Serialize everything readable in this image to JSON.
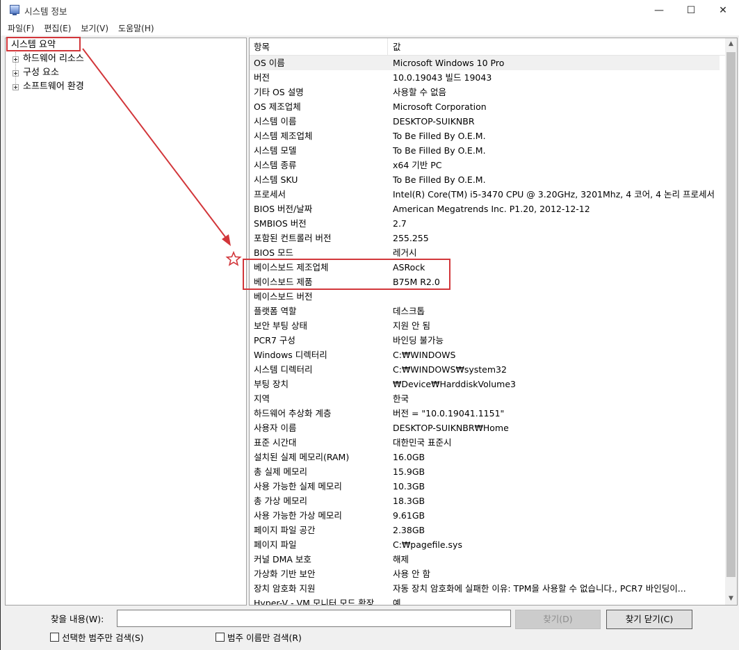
{
  "window": {
    "title": "시스템 정보",
    "minimize": "—",
    "maximize": "☐",
    "close": "✕"
  },
  "menu": [
    "파일(F)",
    "편집(E)",
    "보기(V)",
    "도움말(H)"
  ],
  "tree": {
    "root": "시스템 요약",
    "children": [
      "하드웨어 리소스",
      "구성 요소",
      "소프트웨어 환경"
    ]
  },
  "list": {
    "header_key": "항목",
    "header_value": "값",
    "rows": [
      {
        "key": "OS 이름",
        "value": "Microsoft Windows 10 Pro"
      },
      {
        "key": "버전",
        "value": "10.0.19043 빌드 19043"
      },
      {
        "key": "기타 OS 설명",
        "value": "사용할 수 없음"
      },
      {
        "key": "OS 제조업체",
        "value": "Microsoft Corporation"
      },
      {
        "key": "시스템 이름",
        "value": "DESKTOP-SUIKNBR"
      },
      {
        "key": "시스템 제조업체",
        "value": "To Be Filled By O.E.M."
      },
      {
        "key": "시스템 모델",
        "value": "To Be Filled By O.E.M."
      },
      {
        "key": "시스템 종류",
        "value": "x64 기반 PC"
      },
      {
        "key": "시스템 SKU",
        "value": "To Be Filled By O.E.M."
      },
      {
        "key": "프로세서",
        "value": "Intel(R) Core(TM) i5-3470 CPU @ 3.20GHz, 3201Mhz, 4 코어, 4 논리 프로세서"
      },
      {
        "key": "BIOS 버전/날짜",
        "value": "American Megatrends Inc. P1.20, 2012-12-12"
      },
      {
        "key": "SMBIOS 버전",
        "value": "2.7"
      },
      {
        "key": "포함된 컨트롤러 버전",
        "value": "255.255"
      },
      {
        "key": "BIOS 모드",
        "value": "레거시"
      },
      {
        "key": "베이스보드 제조업체",
        "value": "ASRock"
      },
      {
        "key": "베이스보드 제품",
        "value": "B75M R2.0"
      },
      {
        "key": "베이스보드 버전",
        "value": ""
      },
      {
        "key": "플랫폼 역할",
        "value": "데스크톱"
      },
      {
        "key": "보안 부팅 상태",
        "value": "지원 안 됨"
      },
      {
        "key": "PCR7 구성",
        "value": "바인딩 불가능"
      },
      {
        "key": "Windows 디렉터리",
        "value": "C:₩WINDOWS"
      },
      {
        "key": "시스템 디렉터리",
        "value": "C:₩WINDOWS₩system32"
      },
      {
        "key": "부팅 장치",
        "value": "₩Device₩HarddiskVolume3"
      },
      {
        "key": "지역",
        "value": "한국"
      },
      {
        "key": "하드웨어 추상화 계층",
        "value": "버전 = \"10.0.19041.1151\""
      },
      {
        "key": "사용자 이름",
        "value": "DESKTOP-SUIKNBR₩Home"
      },
      {
        "key": "표준 시간대",
        "value": "대한민국 표준시"
      },
      {
        "key": "설치된 실제 메모리(RAM)",
        "value": "16.0GB"
      },
      {
        "key": "총 실제 메모리",
        "value": "15.9GB"
      },
      {
        "key": "사용 가능한 실제 메모리",
        "value": "10.3GB"
      },
      {
        "key": "총 가상 메모리",
        "value": "18.3GB"
      },
      {
        "key": "사용 가능한 가상 메모리",
        "value": "9.61GB"
      },
      {
        "key": "페이지 파일 공간",
        "value": "2.38GB"
      },
      {
        "key": "페이지 파일",
        "value": "C:₩pagefile.sys"
      },
      {
        "key": "커널 DMA 보호",
        "value": "해제"
      },
      {
        "key": "가상화 기반 보안",
        "value": "사용 안 함"
      },
      {
        "key": "장치 암호화 지원",
        "value": "자동 장치 암호화에 실패한 이유: TPM을 사용할 수 없습니다., PCR7 바인딩이..."
      },
      {
        "key": "Hyper-V - VM 모니터 모드 확장",
        "value": "예"
      }
    ]
  },
  "search": {
    "label": "찾을 내용(W):",
    "value": "",
    "find_button": "찾기(D)",
    "close_find_button": "찾기 닫기(C)",
    "check_selected": "선택한 범주만 검색(S)",
    "check_names": "범주 이름만 검색(R)"
  },
  "colors": {
    "annotation": "#d2363a",
    "selection": "#f0f0f0"
  }
}
